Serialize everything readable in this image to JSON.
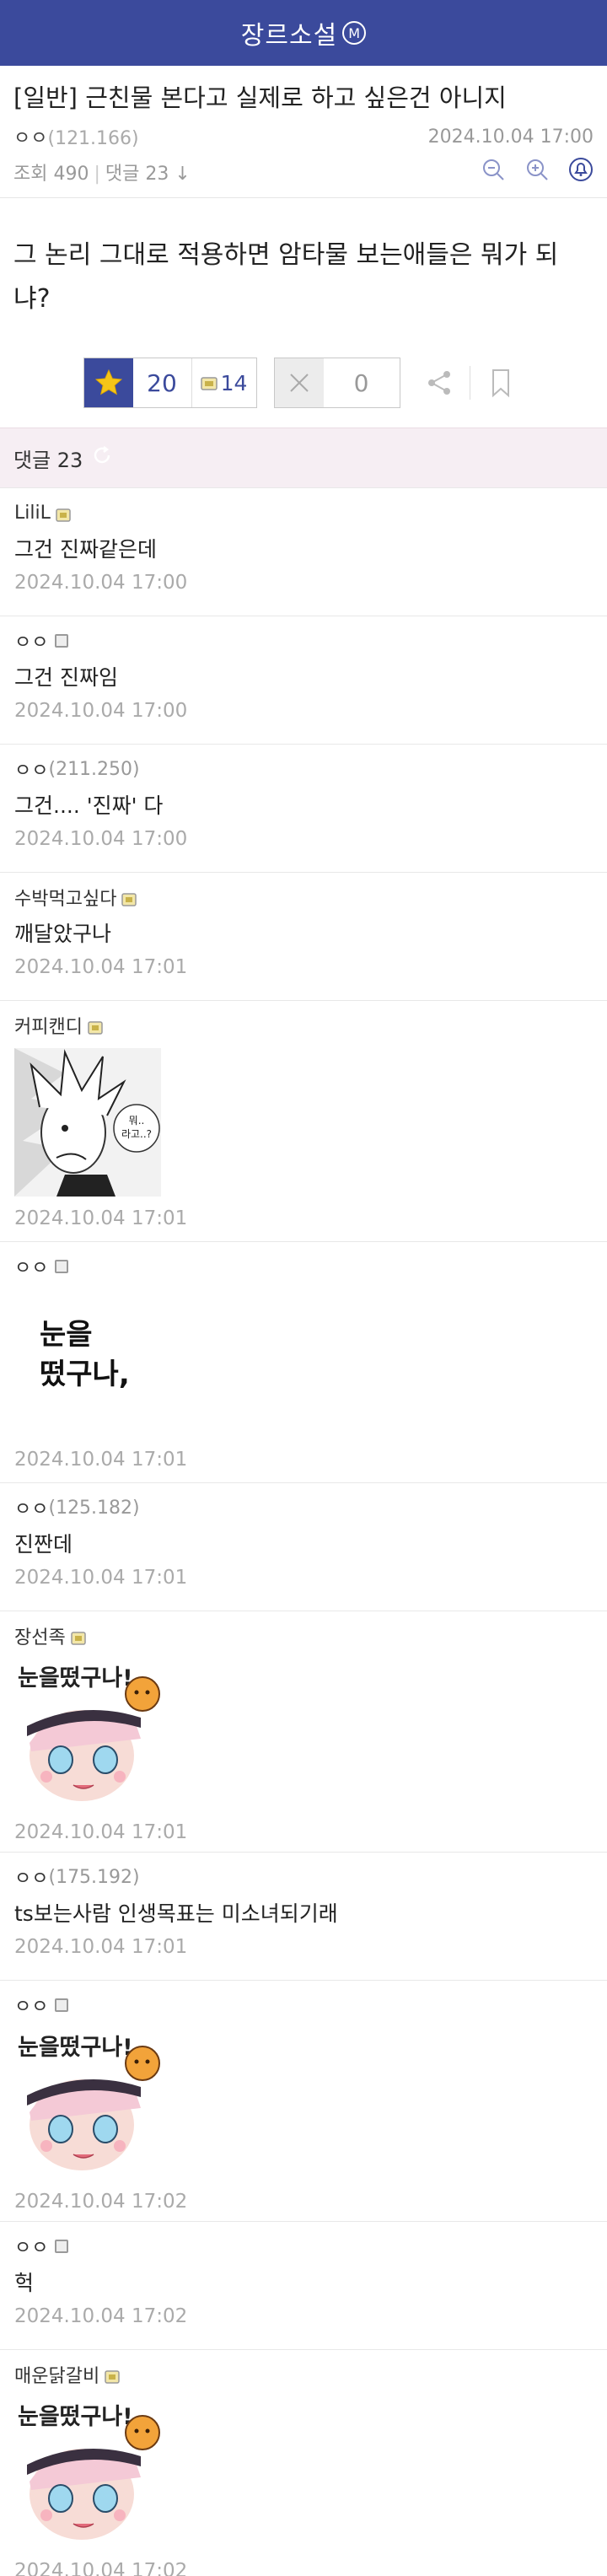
{
  "app": {
    "title": "장르소설",
    "badge": "M",
    "accent": "#3b4a9c"
  },
  "post": {
    "title": "[일반] 근친물 본다고 실제로 하고 싶은건 아니지",
    "author": "ㅇㅇ",
    "author_ip": "(121.166)",
    "date": "2024.10.04 17:00",
    "views_label": "조회 490",
    "comments_label": "댓글 23",
    "body": "그 논리 그대로 적용하면 암타물 보는애들은 뭐가 되냐?"
  },
  "votes": {
    "up": "20",
    "up_sub": "14",
    "down": "0"
  },
  "comment_header": {
    "label": "댓글 23"
  },
  "comments": [
    {
      "name": "LiliL",
      "ip": "",
      "text": "그건 진짜같은데",
      "date": "2024.10.04 17:00"
    },
    {
      "name": "ㅇㅇ",
      "ip": "",
      "text": "그건 진짜임",
      "date": "2024.10.04 17:00"
    },
    {
      "name": "ㅇㅇ",
      "ip": "(211.250)",
      "text": "그건.... '진짜' 다",
      "date": "2024.10.04 17:00"
    },
    {
      "name": "수박먹고싶다",
      "ip": "",
      "text": "깨달았구나",
      "date": "2024.10.04 17:01"
    },
    {
      "name": "커피캔디",
      "ip": "",
      "image_text": "뭐..\n라고..?",
      "date": "2024.10.04 17:01"
    },
    {
      "name": "ㅇㅇ",
      "ip": "",
      "image_text": "눈을\n떴구나,",
      "date": "2024.10.04 17:01"
    },
    {
      "name": "ㅇㅇ",
      "ip": "(125.182)",
      "text": "진짠데",
      "date": "2024.10.04 17:01"
    },
    {
      "name": "장선족",
      "ip": "",
      "image_text": "눈을떴구나!",
      "date": "2024.10.04 17:01"
    },
    {
      "name": "ㅇㅇ",
      "ip": "(175.192)",
      "text": "ts보는사람 인생목표는 미소녀되기래",
      "date": "2024.10.04 17:01"
    },
    {
      "name": "ㅇㅇ",
      "ip": "",
      "image_text": "눈을떴구나!",
      "date": "2024.10.04 17:02"
    },
    {
      "name": "ㅇㅇ",
      "ip": "",
      "text": "헉",
      "date": "2024.10.04 17:02"
    },
    {
      "name": "매운닭갈비",
      "ip": "",
      "image_text": "눈을떴구나!",
      "date": "2024.10.04 17:02"
    }
  ]
}
